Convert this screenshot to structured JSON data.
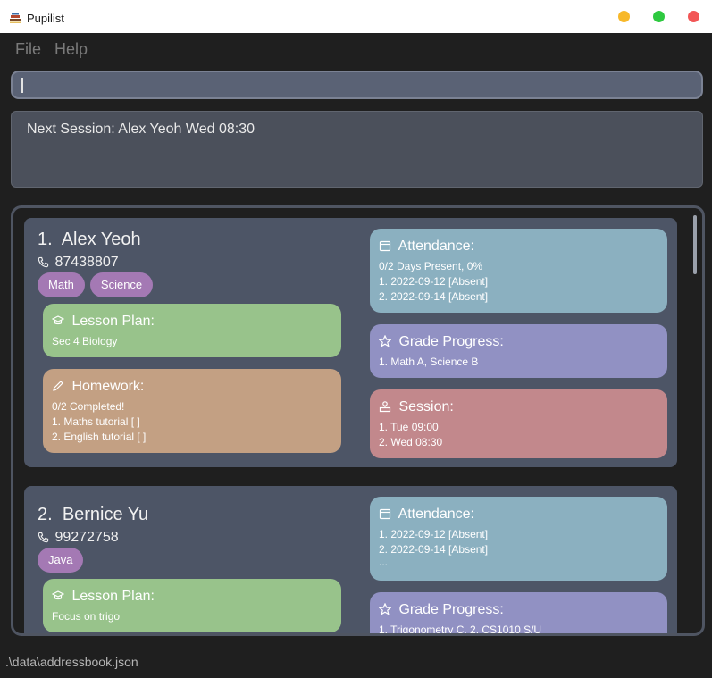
{
  "window": {
    "title": "Pupilist",
    "icons": {
      "app": "books-icon",
      "minimize": "minimize-dot",
      "maximize": "maximize-dot",
      "close": "close-dot"
    },
    "colors": {
      "minimize": "#f7b82a",
      "maximize": "#2ec940",
      "close": "#f25656"
    }
  },
  "menu": {
    "file": "File",
    "help": "Help"
  },
  "command": {
    "value": ""
  },
  "result": {
    "text": "Next Session: Alex Yeoh Wed 08:30"
  },
  "students": [
    {
      "index": "1.",
      "name": "Alex Yeoh",
      "phone": "87438807",
      "tags": [
        "Math",
        "Science"
      ],
      "lesson_plan": {
        "title": "Lesson Plan:",
        "lines": [
          "Sec 4 Biology"
        ]
      },
      "homework": {
        "title": "Homework:",
        "lines": [
          "0/2 Completed!",
          "1. Maths tutorial [ ]",
          "2. English tutorial [ ]"
        ]
      },
      "attendance": {
        "title": "Attendance:",
        "lines": [
          "0/2 Days Present, 0%",
          "1. 2022-09-12 [Absent]",
          "2. 2022-09-14 [Absent]"
        ]
      },
      "grade": {
        "title": "Grade Progress:",
        "lines": [
          "1. Math A, Science B"
        ]
      },
      "session": {
        "title": "Session:",
        "lines": [
          "1. Tue 09:00",
          "2. Wed 08:30"
        ]
      }
    },
    {
      "index": "2.",
      "name": "Bernice Yu",
      "phone": "99272758",
      "tags": [
        "Java"
      ],
      "lesson_plan": {
        "title": "Lesson Plan:",
        "lines": [
          "Focus on trigo"
        ]
      },
      "attendance": {
        "title": "Attendance:",
        "lines": [
          "1. 2022-09-12 [Absent]",
          "2. 2022-09-14 [Absent]",
          "..."
        ]
      },
      "grade": {
        "title": "Grade Progress:",
        "lines": [
          "1. Trigonometry C, 2. CS1010 S/U"
        ]
      }
    }
  ],
  "status": {
    "path": ".\\data\\addressbook.json"
  },
  "colors": {
    "lesson_plan": "#98c38b",
    "homework": "#c3a083",
    "attendance": "#8bb0c0",
    "grade": "#9191c3",
    "session": "#c2888c",
    "tag": "#a479b4",
    "card": "#4d5566"
  }
}
